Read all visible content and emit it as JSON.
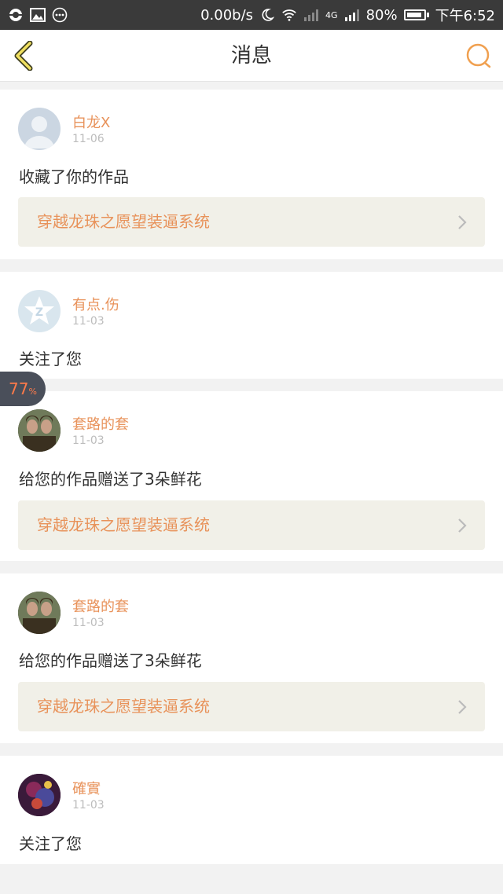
{
  "status_bar": {
    "network_speed": "0.00b/s",
    "network_type": "4G",
    "battery": "80%",
    "time": "下午6:52",
    "icons": [
      "app-notification-icon",
      "image-icon",
      "more-dots-icon",
      "moon-icon",
      "wifi-icon",
      "signal-icon",
      "battery-icon"
    ]
  },
  "nav": {
    "title": "消息",
    "back_icon": "chevron-left-icon",
    "search_icon": "search-icon"
  },
  "messages": [
    {
      "user": "白龙X",
      "date": "11-06",
      "action": "收藏了你的作品",
      "work": "穿越龙珠之愿望装逼系统",
      "avatar": "default-avatar"
    },
    {
      "user": "有点.伤",
      "date": "11-03",
      "action": "关注了您",
      "work": "",
      "avatar": "qzone-avatar"
    },
    {
      "user": "套路的套",
      "date": "11-03",
      "action": "给您的作品赠送了3朵鲜花",
      "work": "穿越龙珠之愿望装逼系统",
      "avatar": "photo-avatar"
    },
    {
      "user": "套路的套",
      "date": "11-03",
      "action": "给您的作品赠送了3朵鲜花",
      "work": "穿越龙珠之愿望装逼系统",
      "avatar": "photo-avatar"
    },
    {
      "user": "確實",
      "date": "11-03",
      "action": "关注了您",
      "work": "",
      "avatar": "anime-avatar"
    }
  ],
  "overlay": {
    "progress_value": "77",
    "progress_unit": "%"
  },
  "colors": {
    "accent": "#e8925a",
    "status_bar": "#3a3a3a",
    "work_bg": "#f1f0e8",
    "badge_bg": "#4a4f5a",
    "badge_text": "#ff7a4a"
  }
}
